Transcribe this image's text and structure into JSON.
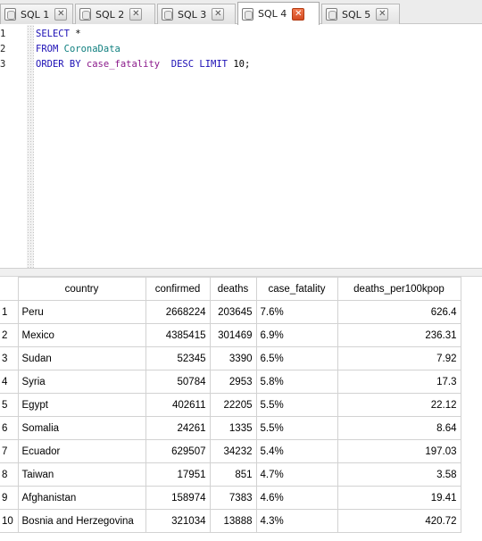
{
  "tabs": [
    {
      "label": "SQL 1",
      "active": false
    },
    {
      "label": "SQL 2",
      "active": false
    },
    {
      "label": "SQL 3",
      "active": false
    },
    {
      "label": "SQL 4",
      "active": true
    },
    {
      "label": "SQL 5",
      "active": false
    }
  ],
  "tab_close_glyph": "✕",
  "editor": {
    "line_numbers": [
      "1",
      "2",
      "3"
    ],
    "lines": [
      {
        "kw1": "SELECT",
        "rest": " *"
      },
      {
        "kw1": "FROM",
        "table": "CoronaData"
      },
      {
        "kw1": "ORDER BY",
        "col": "case_fatality",
        "kw2": "DESC",
        "kw3": "LIMIT",
        "num": "10;"
      }
    ]
  },
  "results": {
    "columns": [
      "country",
      "confirmed",
      "deaths",
      "case_fatality",
      "deaths_per100kpop"
    ],
    "rows": [
      [
        "1",
        "Peru",
        "2668224",
        "203645",
        "7.6%",
        "626.4"
      ],
      [
        "2",
        "Mexico",
        "4385415",
        "301469",
        "6.9%",
        "236.31"
      ],
      [
        "3",
        "Sudan",
        "52345",
        "3390",
        "6.5%",
        "7.92"
      ],
      [
        "4",
        "Syria",
        "50784",
        "2953",
        "5.8%",
        "17.3"
      ],
      [
        "5",
        "Egypt",
        "402611",
        "22205",
        "5.5%",
        "22.12"
      ],
      [
        "6",
        "Somalia",
        "24261",
        "1335",
        "5.5%",
        "8.64"
      ],
      [
        "7",
        "Ecuador",
        "629507",
        "34232",
        "5.4%",
        "197.03"
      ],
      [
        "8",
        "Taiwan",
        "17951",
        "851",
        "4.7%",
        "3.58"
      ],
      [
        "9",
        "Afghanistan",
        "158974",
        "7383",
        "4.6%",
        "19.41"
      ],
      [
        "10",
        "Bosnia and Herzegovina",
        "321034",
        "13888",
        "4.3%",
        "420.72"
      ]
    ]
  }
}
